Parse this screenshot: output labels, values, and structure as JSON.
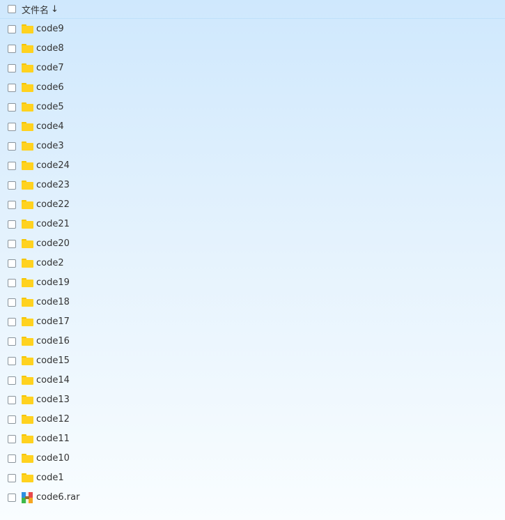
{
  "header": {
    "column_label": "文件名",
    "sort_indicator": "↓",
    "sort_icon": "arrow-down-icon"
  },
  "colors": {
    "folder": "#ffd21f",
    "text": "#333333",
    "background_top": "#cfe8fd",
    "background_bottom": "#f9fdff"
  },
  "files": [
    {
      "name": "code9",
      "type": "folder"
    },
    {
      "name": "code8",
      "type": "folder"
    },
    {
      "name": "code7",
      "type": "folder"
    },
    {
      "name": "code6",
      "type": "folder"
    },
    {
      "name": "code5",
      "type": "folder"
    },
    {
      "name": "code4",
      "type": "folder"
    },
    {
      "name": "code3",
      "type": "folder"
    },
    {
      "name": "code24",
      "type": "folder"
    },
    {
      "name": "code23",
      "type": "folder"
    },
    {
      "name": "code22",
      "type": "folder"
    },
    {
      "name": "code21",
      "type": "folder"
    },
    {
      "name": "code20",
      "type": "folder"
    },
    {
      "name": "code2",
      "type": "folder"
    },
    {
      "name": "code19",
      "type": "folder"
    },
    {
      "name": "code18",
      "type": "folder"
    },
    {
      "name": "code17",
      "type": "folder"
    },
    {
      "name": "code16",
      "type": "folder"
    },
    {
      "name": "code15",
      "type": "folder"
    },
    {
      "name": "code14",
      "type": "folder"
    },
    {
      "name": "code13",
      "type": "folder"
    },
    {
      "name": "code12",
      "type": "folder"
    },
    {
      "name": "code11",
      "type": "folder"
    },
    {
      "name": "code10",
      "type": "folder"
    },
    {
      "name": "code1",
      "type": "folder"
    },
    {
      "name": "code6.rar",
      "type": "rar"
    }
  ]
}
